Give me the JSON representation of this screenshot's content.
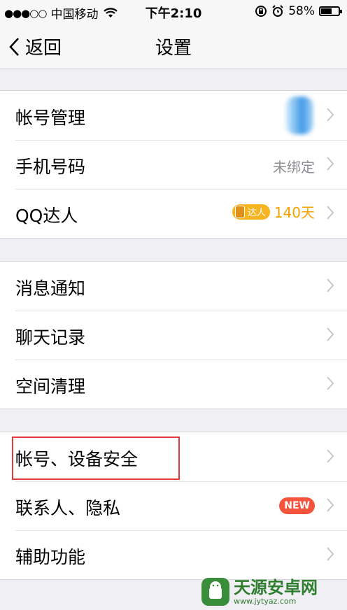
{
  "status_bar": {
    "signal": "●●●○○",
    "carrier": "中国移动",
    "time": "下午2:10",
    "battery_percent": "58%",
    "battery_level": 0.58
  },
  "nav": {
    "back_label": "返回",
    "title": "设置"
  },
  "group1": [
    {
      "label": "帐号管理"
    },
    {
      "label": "手机号码",
      "value": "未绑定"
    },
    {
      "label": "QQ达人",
      "badge": "达人",
      "days": "140天"
    }
  ],
  "group2": [
    {
      "label": "消息通知"
    },
    {
      "label": "聊天记录"
    },
    {
      "label": "空间清理"
    }
  ],
  "group3": [
    {
      "label": "帐号、设备安全"
    },
    {
      "label": "联系人、隐私",
      "badge": "NEW"
    },
    {
      "label": "辅助功能"
    }
  ],
  "watermark": {
    "main": "天源安卓网",
    "sub": "www.jytyaz.com"
  },
  "colors": {
    "background": "#efeff4",
    "highlight": "#e23a3a",
    "vip": "#f5a300",
    "new_badge": "#f5543c"
  }
}
